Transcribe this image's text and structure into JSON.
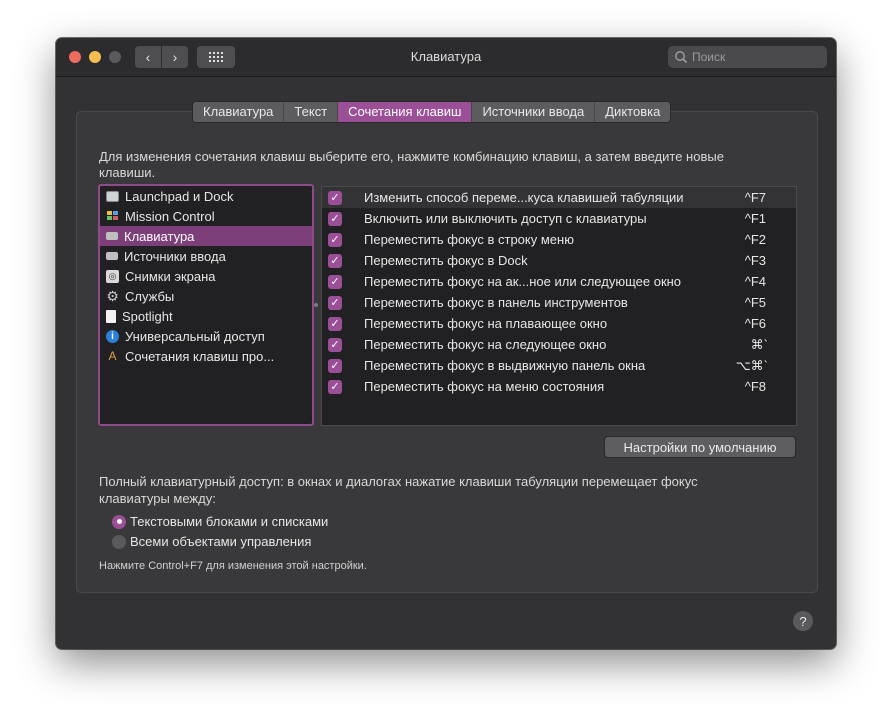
{
  "window": {
    "title": "Клавиатура"
  },
  "search": {
    "placeholder": "Поиск"
  },
  "tabs": [
    {
      "label": "Клавиатура",
      "active": false
    },
    {
      "label": "Текст",
      "active": false
    },
    {
      "label": "Сочетания клавиш",
      "active": true
    },
    {
      "label": "Источники ввода",
      "active": false
    },
    {
      "label": "Диктовка",
      "active": false
    }
  ],
  "instructions": "Для изменения сочетания клавиш выберите его, нажмите комбинацию клавиш, а затем введите новые клавиши.",
  "categories": [
    {
      "label": "Launchpad и Dock",
      "icon": "launchpad-icon"
    },
    {
      "label": "Mission Control",
      "icon": "mission-control-icon"
    },
    {
      "label": "Клавиатура",
      "icon": "keyboard-icon",
      "selected": true
    },
    {
      "label": "Источники ввода",
      "icon": "input-sources-icon"
    },
    {
      "label": "Снимки экрана",
      "icon": "screenshot-icon"
    },
    {
      "label": "Службы",
      "icon": "services-gear-icon"
    },
    {
      "label": "Spotlight",
      "icon": "spotlight-icon"
    },
    {
      "label": "Универсальный доступ",
      "icon": "accessibility-icon"
    },
    {
      "label": "Сочетания клавиш про...",
      "icon": "app-shortcuts-icon"
    }
  ],
  "shortcuts": [
    {
      "label": "Изменить способ переме...куса клавишей табуляции",
      "key": "^F7",
      "checked": true
    },
    {
      "label": "Включить или выключить доступ с клавиатуры",
      "key": "^F1",
      "checked": true
    },
    {
      "label": "Переместить фокус в строку меню",
      "key": "^F2",
      "checked": true
    },
    {
      "label": "Переместить фокус в Dock",
      "key": "^F3",
      "checked": true
    },
    {
      "label": "Переместить фокус на ак...ное или следующее окно",
      "key": "^F4",
      "checked": true
    },
    {
      "label": "Переместить фокус в панель инструментов",
      "key": "^F5",
      "checked": true
    },
    {
      "label": "Переместить фокус на плавающее окно",
      "key": "^F6",
      "checked": true
    },
    {
      "label": "Переместить фокус на следующее окно",
      "key": "⌘`",
      "checked": true
    },
    {
      "label": "Переместить фокус в выдвижную панель окна",
      "key": "⌥⌘`",
      "checked": true
    },
    {
      "label": "Переместить фокус на меню состояния",
      "key": "^F8",
      "checked": true
    }
  ],
  "defaults_button": "Настройки по умолчанию",
  "full_keyboard_access": {
    "text": "Полный клавиатурный доступ: в окнах и диалогах нажатие клавиши табуляции перемещает фокус клавиатуры между:",
    "options": [
      {
        "label": "Текстовыми блоками и списками",
        "selected": true
      },
      {
        "label": "Всеми объектами управления",
        "selected": false
      }
    ]
  },
  "hint": "Нажмите Control+F7 для изменения этой настройки.",
  "help_label": "?",
  "colors": {
    "accent": "#9b4f96",
    "window_bg": "#323234",
    "list_bg": "#212123"
  }
}
